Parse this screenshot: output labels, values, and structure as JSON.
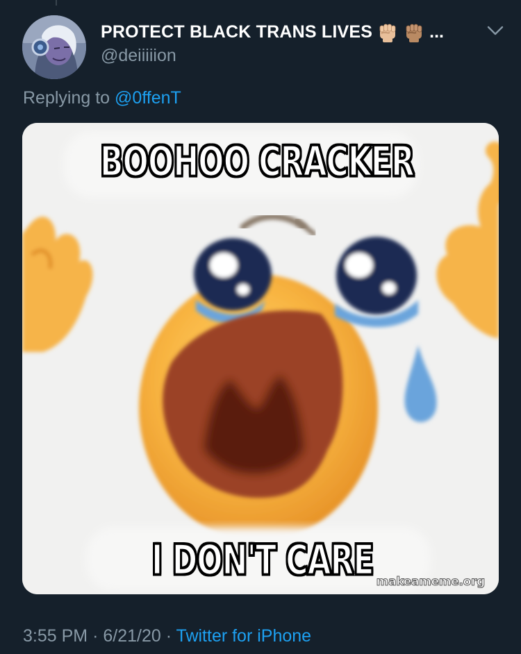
{
  "tweet": {
    "display_name": "PROTECT BLACK TRANS LIVES",
    "name_emojis": [
      "raised-fist-light-skin-tone",
      "raised-fist-medium-skin-tone"
    ],
    "name_overflow": "...",
    "username": "@deiiiiion",
    "reply_prefix": "Replying to",
    "reply_mention": "@0ffenT",
    "time": "3:55 PM",
    "separator": "·",
    "date": "6/21/20",
    "source": "Twitter for iPhone"
  },
  "media": {
    "top_caption": "BOOHOO CRACKER",
    "bottom_caption": "I DON'T CARE",
    "watermark": "makeameme.org"
  },
  "colors": {
    "background": "#15202b",
    "secondary_text": "#8899a6",
    "link": "#1da1f2",
    "primary_text": "#ffffff"
  }
}
